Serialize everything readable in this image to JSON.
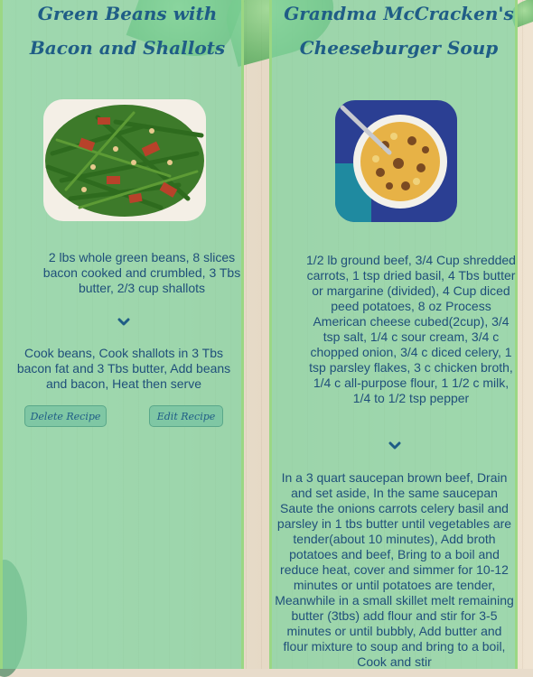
{
  "recipes": [
    {
      "title": "Green Beans with Bacon and Shallots",
      "ingredients": "2 lbs whole green beans, 8 slices bacon cooked and crumbled, 3 Tbs butter, 2/3 cup shallots",
      "directions": "Cook beans, Cook shallots in 3 Tbs bacon fat and 3 Tbs butter, Add beans and bacon, Heat then serve",
      "delete_label": "Delete Recipe",
      "edit_label": "Edit Recipe",
      "expand_icon": "chevron-down-icon"
    },
    {
      "title": "Grandma McCracken's Cheeseburger Soup",
      "ingredients": "1/2 lb ground beef, 3/4 Cup shredded carrots, 1 tsp dried basil, 4 Tbs butter or margarine (divided), 4 Cup diced peed potatoes, 8 oz Process American cheese cubed(2cup), 3/4 tsp salt, 1/4 c sour cream, 3/4 c chopped onion, 3/4 c diced celery, 1 tsp parsley flakes, 3 c chicken broth, 1/4 c all-purpose flour, 1 1/2 c milk, 1/4 to 1/2 tsp pepper",
      "directions": "In a 3 quart saucepan brown beef, Drain and set aside, In the same saucepan Saute the onions carrots celery basil and parsley in 1 tbs butter until vegetables are tender(about 10 minutes), Add broth potatoes and beef, Bring to a boil and reduce heat, cover and simmer for 10-12 minutes or until potatoes are tender, Meanwhile in a small skillet melt remaining butter (3tbs) add flour and stir for 3-5 minutes or until bubbly, Add butter and flour mixture to soup and bring to a boil, Cook and stir",
      "expand_icon": "chevron-down-icon"
    }
  ],
  "colors": {
    "card_bg": "#80d2a0",
    "card_border": "#9bd782",
    "text": "#1f4f7a",
    "button_bg": "#7fc7a4"
  }
}
